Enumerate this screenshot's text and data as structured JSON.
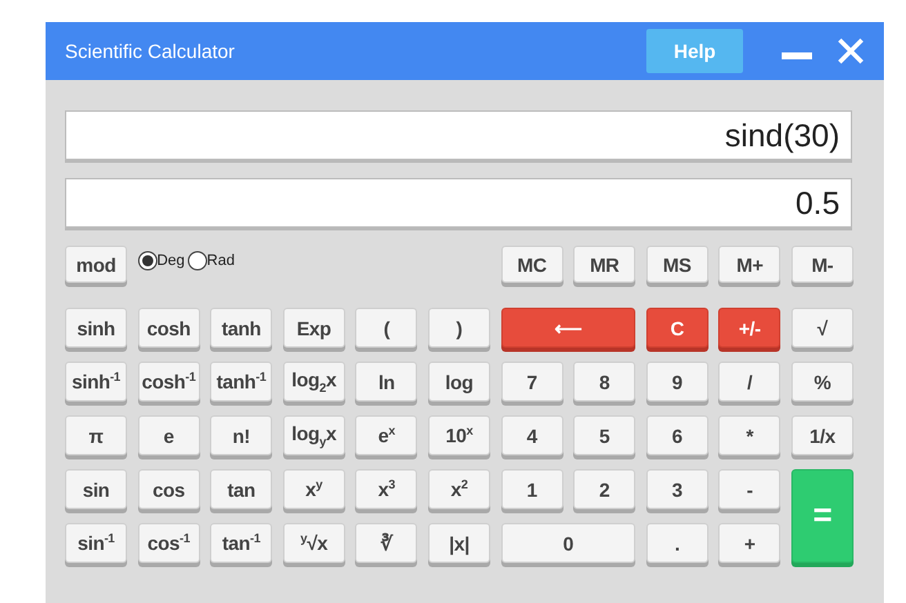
{
  "window": {
    "title": "Scientific Calculator",
    "help_label": "Help"
  },
  "displays": [
    {
      "value": "sind(30)"
    },
    {
      "value": "0.5"
    }
  ],
  "mode_key": "mod",
  "angle_modes": [
    {
      "label": "Deg",
      "selected": true
    },
    {
      "label": "Rad",
      "selected": false
    }
  ],
  "memory_keys": [
    "MC",
    "MR",
    "MS",
    "M+",
    "M-"
  ],
  "keys": [
    {
      "label": "sinh",
      "kind": "plain"
    },
    {
      "label": "cosh",
      "kind": "plain"
    },
    {
      "label": "tanh",
      "kind": "plain"
    },
    {
      "label": "Exp",
      "kind": "plain"
    },
    {
      "label": "(",
      "kind": "plain"
    },
    {
      "label": ")",
      "kind": "plain"
    },
    {
      "label": "⟵",
      "kind": "red",
      "wide": true
    },
    {
      "label": "C",
      "kind": "red"
    },
    {
      "label": "+/-",
      "kind": "red"
    },
    {
      "label": "√",
      "kind": "plain"
    },
    {
      "label": "sinh$^{-1}$",
      "kind": "plain"
    },
    {
      "label": "cosh$^{-1}$",
      "kind": "plain"
    },
    {
      "label": "tanh$^{-1}$",
      "kind": "plain"
    },
    {
      "label": "log$_{2}$x",
      "kind": "plain"
    },
    {
      "label": "ln",
      "kind": "plain"
    },
    {
      "label": "log",
      "kind": "plain"
    },
    {
      "label": "7",
      "kind": "plain"
    },
    {
      "label": "8",
      "kind": "plain"
    },
    {
      "label": "9",
      "kind": "plain"
    },
    {
      "label": "/",
      "kind": "plain"
    },
    {
      "label": "%",
      "kind": "plain"
    },
    {
      "label": "π",
      "kind": "plain"
    },
    {
      "label": "e",
      "kind": "plain"
    },
    {
      "label": "n!",
      "kind": "plain"
    },
    {
      "label": "log$_{y}$x",
      "kind": "plain"
    },
    {
      "label": "e$^{x}$",
      "kind": "plain"
    },
    {
      "label": "10$^{x}$",
      "kind": "plain"
    },
    {
      "label": "4",
      "kind": "plain"
    },
    {
      "label": "5",
      "kind": "plain"
    },
    {
      "label": "6",
      "kind": "plain"
    },
    {
      "label": "*",
      "kind": "plain"
    },
    {
      "label": "1/x",
      "kind": "plain"
    },
    {
      "label": "sin",
      "kind": "plain"
    },
    {
      "label": "cos",
      "kind": "plain"
    },
    {
      "label": "tan",
      "kind": "plain"
    },
    {
      "label": "x$^{y}$",
      "kind": "plain"
    },
    {
      "label": "x$^{3}$",
      "kind": "plain"
    },
    {
      "label": "x$^{2}$",
      "kind": "plain"
    },
    {
      "label": "1",
      "kind": "plain"
    },
    {
      "label": "2",
      "kind": "plain"
    },
    {
      "label": "3",
      "kind": "plain"
    },
    {
      "label": "-",
      "kind": "plain"
    },
    {
      "label": "=",
      "kind": "green",
      "tall": true
    },
    {
      "label": "sin$^{-1}$",
      "kind": "plain"
    },
    {
      "label": "cos$^{-1}$",
      "kind": "plain"
    },
    {
      "label": "tan$^{-1}$",
      "kind": "plain"
    },
    {
      "label": "$^{y}$√x",
      "kind": "plain"
    },
    {
      "label": "∛",
      "kind": "plain"
    },
    {
      "label": "|x|",
      "kind": "plain"
    },
    {
      "label": "0",
      "kind": "plain",
      "wide": true
    },
    {
      "label": ".",
      "kind": "plain"
    },
    {
      "label": "+",
      "kind": "plain"
    }
  ]
}
